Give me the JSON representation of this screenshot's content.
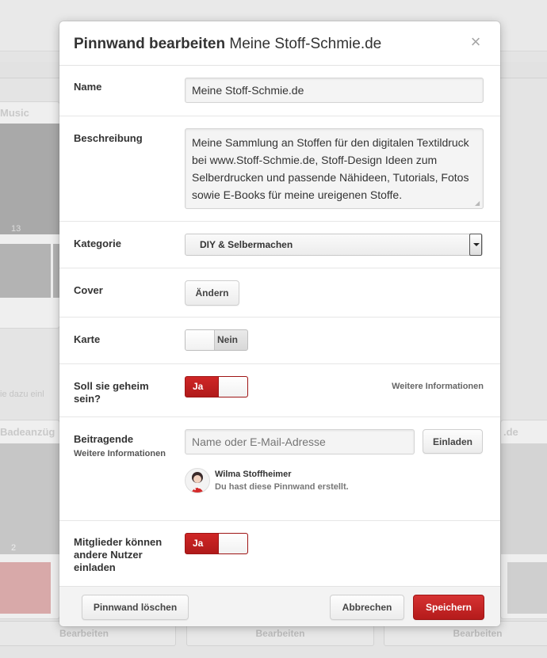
{
  "background": {
    "section_music": "Music",
    "pin_count_1": "13",
    "hint_text": "ie dazu einl",
    "section_bade": "Badeanzüg",
    "section_right": ".de",
    "pin_count_2": "2",
    "edit_labels": [
      "Bearbeiten",
      "Bearbeiten",
      "Bearbeiten"
    ]
  },
  "modal": {
    "title_bold": "Pinnwand bearbeiten",
    "title_name": "Meine Stoff-Schmie.de",
    "close_icon": "close-icon",
    "name_label": "Name",
    "name_value": "Meine Stoff-Schmie.de",
    "description_label": "Beschreibung",
    "description_value": "Meine Sammlung an Stoffen für den digitalen Textildruck bei www.Stoff-Schmie.de, Stoff-Design Ideen zum Selberdrucken und passende Nähideen, Tutorials, Fotos sowie E-Books für meine ureigenen Stoffe.",
    "category_label": "Kategorie",
    "category_value": "DIY & Selbermachen",
    "cover_label": "Cover",
    "cover_button": "Ändern",
    "map_label": "Karte",
    "map_toggle": "Nein",
    "secret_label": "Soll sie geheim sein?",
    "secret_toggle": "Ja",
    "secret_info_link": "Weitere Informationen",
    "contributors_label": "Beitragende",
    "contributors_info_link": "Weitere Informationen",
    "contributors_placeholder": "Name oder E-Mail-Adresse",
    "invite_button": "Einladen",
    "owner_name": "Wilma Stoffheimer",
    "owner_note": "Du hast diese Pinnwand erstellt.",
    "members_invite_label": "Mitglieder können andere Nutzer einladen",
    "members_invite_toggle": "Ja",
    "delete_button": "Pinnwand löschen",
    "cancel_button": "Abbrechen",
    "save_button": "Speichern"
  },
  "colors": {
    "accent_red": "#c22020",
    "overlay": "#e4e4e4"
  }
}
